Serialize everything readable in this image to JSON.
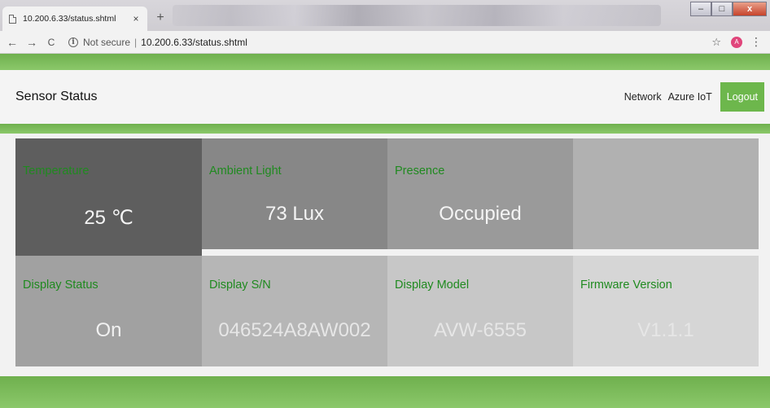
{
  "browser": {
    "tab_title": "10.200.6.33/status.shtml",
    "tab_close": "×",
    "new_tab": "+",
    "back": "←",
    "forward": "→",
    "reload": "C",
    "not_secure": "Not secure",
    "separator": "|",
    "url": "10.200.6.33/status.shtml",
    "bookmark": "☆",
    "profile_initial": "A",
    "menu": "⋮",
    "win_minimize": "–",
    "win_maximize": "□",
    "win_close": "x"
  },
  "header": {
    "title": "Sensor Status",
    "nav": [
      "Network",
      "Azure IoT"
    ],
    "logout": "Logout"
  },
  "tiles": [
    {
      "label": "Temperature",
      "value": "25 ℃",
      "bg": "#5e5e5e"
    },
    {
      "label": "Ambient Light",
      "value": "73 Lux",
      "bg": "#878787"
    },
    {
      "label": "Presence",
      "value": "Occupied",
      "bg": "#9a9a9a"
    },
    {
      "label": "",
      "value": "",
      "bg": "#b1b1b1"
    },
    {
      "label": "Display Status",
      "value": "On",
      "bg": "#a1a1a1"
    },
    {
      "label": "Display S/N",
      "value": "046524A8AW002",
      "bg": "#b6b6b6"
    },
    {
      "label": "Display Model",
      "value": "AVW-6555",
      "bg": "#c7c7c7"
    },
    {
      "label": "Firmware Version",
      "value": "V1.1.1",
      "bg": "#d6d6d6"
    }
  ],
  "colors": {
    "accent_green": "#6db74c",
    "label_green": "#1f8a1f"
  }
}
